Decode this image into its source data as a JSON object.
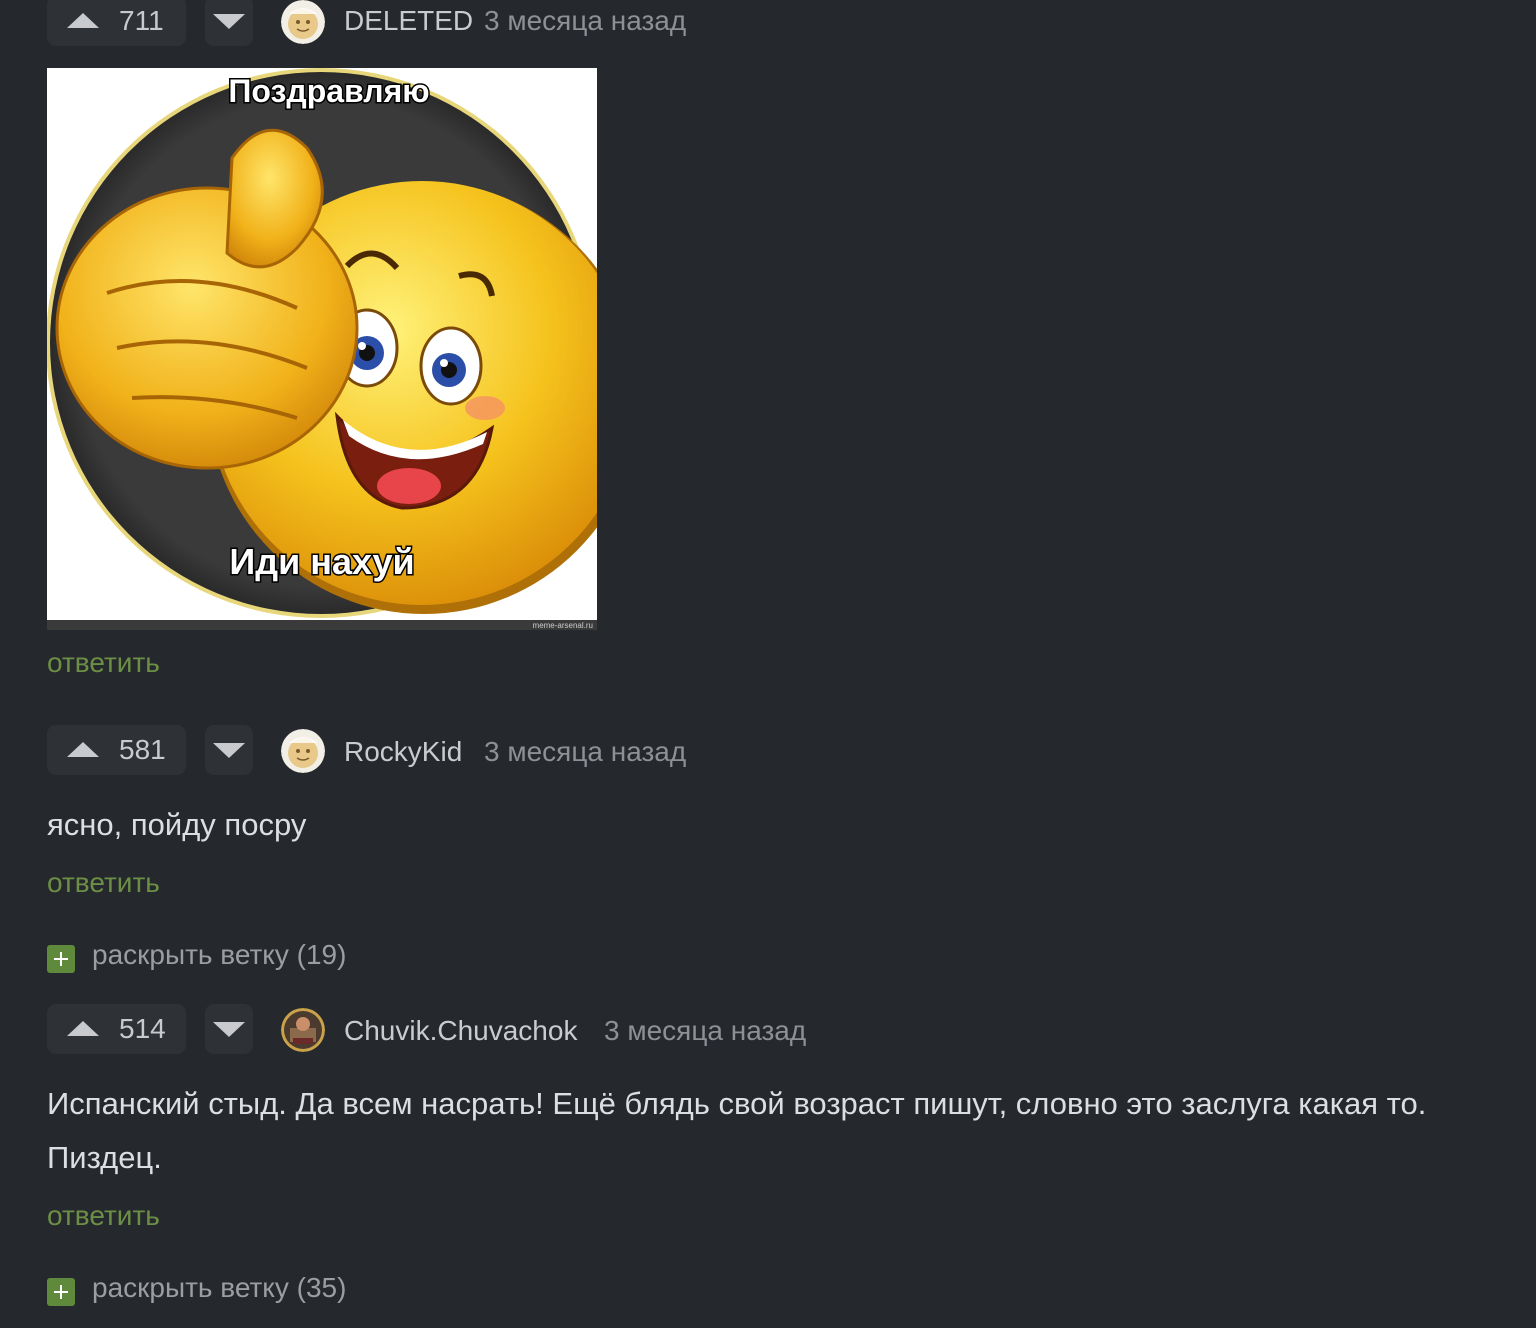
{
  "comments": [
    {
      "votes": "711",
      "username": "DELETED",
      "time": "3 месяца назад",
      "meme": {
        "top_text": "Поздравляю",
        "bottom_text": "Иди нахуй",
        "watermark": "meme-arsenal.ru"
      },
      "reply_label": "ответить"
    },
    {
      "votes": "581",
      "username": "RockyKid",
      "time": "3 месяца назад",
      "text": "ясно, пойду посру",
      "reply_label": "ответить",
      "expand_label": "раскрыть ветку (19)"
    },
    {
      "votes": "514",
      "username": "Chuvik.Chuvachok",
      "time": "3 месяца назад",
      "text": "Испанский стыд. Да всем насрать! Ещё блядь свой возраст пишут, словно это заслуга какая то. Пиздец.",
      "reply_label": "ответить",
      "expand_label": "раскрыть ветку (35)"
    }
  ],
  "colors": {
    "background": "#25282d",
    "button_bg": "#2e3136",
    "reply_green": "#6c8f45",
    "expand_green": "#5f8a3c"
  }
}
